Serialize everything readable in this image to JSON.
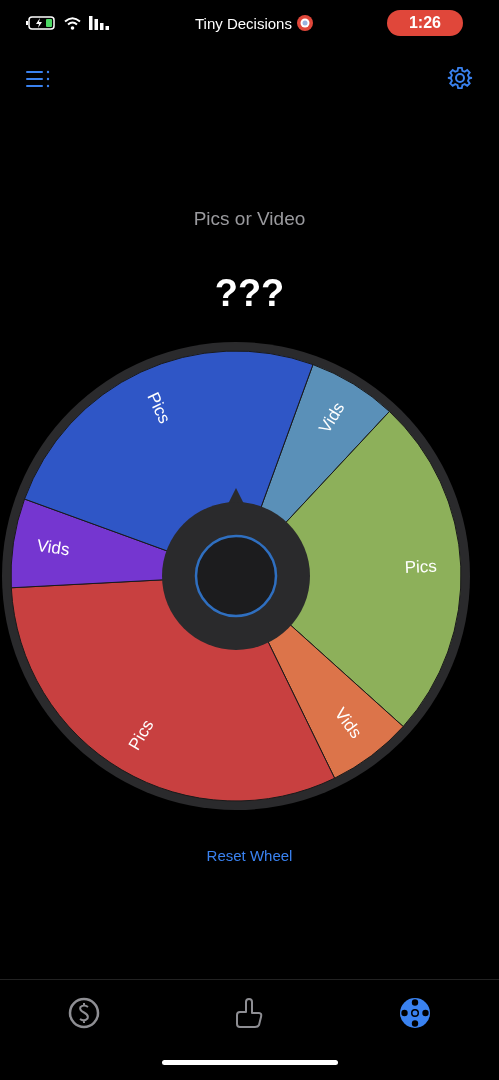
{
  "status_bar": {
    "time": "1:26",
    "app_label": "Tiny Decisions"
  },
  "wheel": {
    "title": "Pics or Video",
    "result": "???",
    "segments": [
      {
        "label": "Vids",
        "color": "#5a90b8"
      },
      {
        "label": "Pics",
        "color": "#8db05a"
      },
      {
        "label": "Vids",
        "color": "#dc744a"
      },
      {
        "label": "Pics",
        "color": "#c84040"
      },
      {
        "label": "Vids",
        "color": "#7536d0"
      },
      {
        "label": "Pics",
        "color": "#2f56c6"
      }
    ],
    "reset_label": "Reset Wheel"
  },
  "tab_bar": [
    {
      "kind": "coin",
      "selected": false
    },
    {
      "kind": "tap",
      "selected": false
    },
    {
      "kind": "wheel",
      "selected": true
    }
  ]
}
